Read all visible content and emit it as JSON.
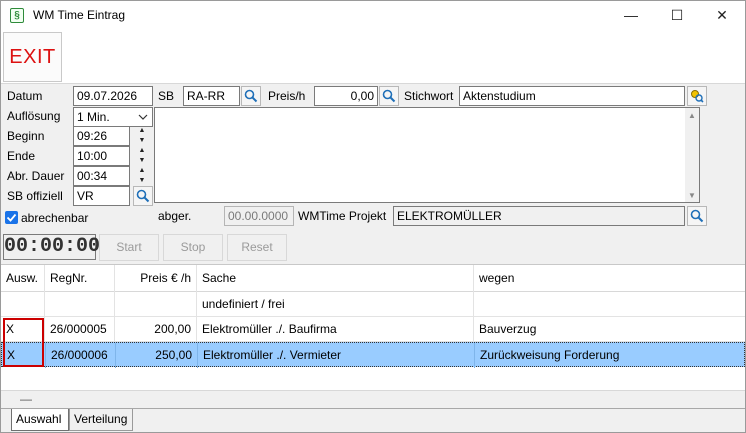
{
  "window": {
    "title": "WM Time Eintrag",
    "app_icon_glyph": "§",
    "minimize_glyph": "—",
    "maximize_glyph": "☐",
    "close_glyph": "✕"
  },
  "toolbar": {
    "exit_label": "EXIT"
  },
  "form": {
    "datum_label": "Datum",
    "datum_value": "09.07.2026",
    "sb_label": "SB",
    "sb_value": "RA-RR",
    "preis_label": "Preis/h",
    "preis_value": "0,00",
    "stichwort_label": "Stichwort",
    "stichwort_value": "Aktenstudium",
    "aufloesung_label": "Auflösung",
    "aufloesung_value": "1 Min.",
    "beginn_label": "Beginn",
    "beginn_value": "09:26",
    "ende_label": "Ende",
    "ende_value": "10:00",
    "abr_dauer_label": "Abr. Dauer",
    "abr_dauer_value": "00:34",
    "sb_offiziell_label": "SB offiziell",
    "sb_offiziell_value": "VR",
    "abrechenbar_label": "abrechenbar",
    "abrechenbar_checked": true,
    "abger_label": "abger.",
    "abger_value": "00.00.0000",
    "projekt_label": "WMTime Projekt",
    "projekt_value": "ELEKTROMÜLLER",
    "memo_text": ""
  },
  "timer": {
    "display": "00:00:00",
    "start_label": "Start",
    "stop_label": "Stop",
    "reset_label": "Reset"
  },
  "table": {
    "columns": [
      "Ausw.",
      "RegNr.",
      "Preis € /h",
      "Sache",
      "wegen"
    ],
    "rows": [
      {
        "ausw": "",
        "regnr": "",
        "preis": "",
        "sache": "undefiniert / frei",
        "wegen": ""
      },
      {
        "ausw": "X",
        "regnr": "26/000005",
        "preis": "200,00",
        "sache": "Elektromüller ./. Baufirma",
        "wegen": "Bauverzug"
      },
      {
        "ausw": "X",
        "regnr": "26/000006",
        "preis": "250,00",
        "sache": "Elektromüller ./. Vermieter",
        "wegen": "Zurückweisung Forderung"
      }
    ],
    "selected_row": 2,
    "footer_glyph": "—"
  },
  "tabs": [
    "Auswahl",
    "Verteilung"
  ],
  "colors": {
    "exit": "#dd1111",
    "selection": "#99ccff",
    "marker_border": "#cc0000",
    "checkbox": "#1a73e8"
  }
}
